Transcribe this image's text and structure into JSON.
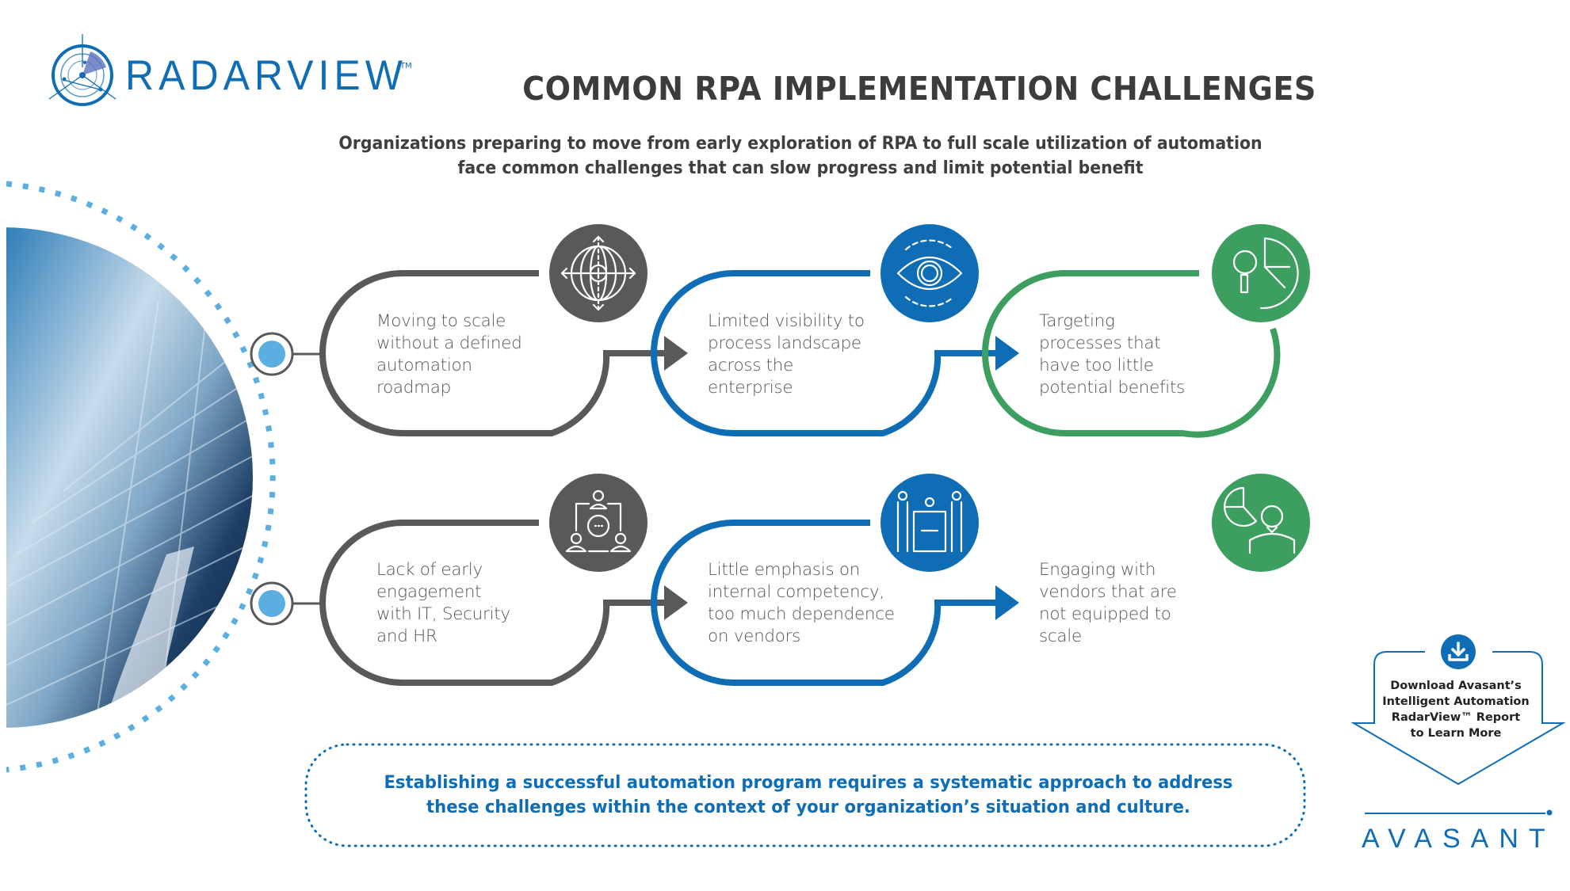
{
  "brand": {
    "logo_text": "RADARVIEW",
    "logo_tm": "TM",
    "footer_logo_text": "AVASANT"
  },
  "colors": {
    "gray": "#58595b",
    "blue": "#0f6db5",
    "green": "#3c9e5f",
    "light_blue": "#5aaee0",
    "title": "#3c3c3c"
  },
  "header": {
    "title": "COMMON RPA IMPLEMENTATION CHALLENGES",
    "subtitle_line1": "Organizations preparing to move from early exploration of RPA to full scale utilization of automation",
    "subtitle_line2": "face common challenges that can slow progress and limit potential benefit"
  },
  "challenges": [
    {
      "text": "Moving to scale\nwithout a defined\nautomation\nroadmap",
      "icon": "globe-arrows-icon",
      "color": "gray"
    },
    {
      "text": "Limited visibility to\nprocess landscape\nacross the\nenterprise",
      "icon": "eye-gear-icon",
      "color": "blue"
    },
    {
      "text": "Targeting\nprocesses that\nhave too little\npotential benefits",
      "icon": "magnifier-pie-chart-icon",
      "color": "green"
    },
    {
      "text": "Lack of early\nengagement\nwith IT, Security\nand HR",
      "icon": "team-meeting-icon",
      "color": "gray"
    },
    {
      "text": "Little emphasis on\ninternal competency,\ntoo much dependence\non vendors",
      "icon": "puzzle-team-icon",
      "color": "blue"
    },
    {
      "text": "Engaging with\nvendors that are\nnot equipped to\nscale",
      "icon": "person-pie-chart-icon",
      "color": "green"
    }
  ],
  "callout": {
    "line1": "Establishing a successful automation program requires a systematic approach to address",
    "line2": "these challenges within the context of your organization’s situation and culture."
  },
  "download": {
    "icon": "download-icon",
    "line1": "Download Avasant’s",
    "line2": "Intelligent Automation",
    "line3": "RadarView™ Report",
    "line4": "to Learn More"
  }
}
